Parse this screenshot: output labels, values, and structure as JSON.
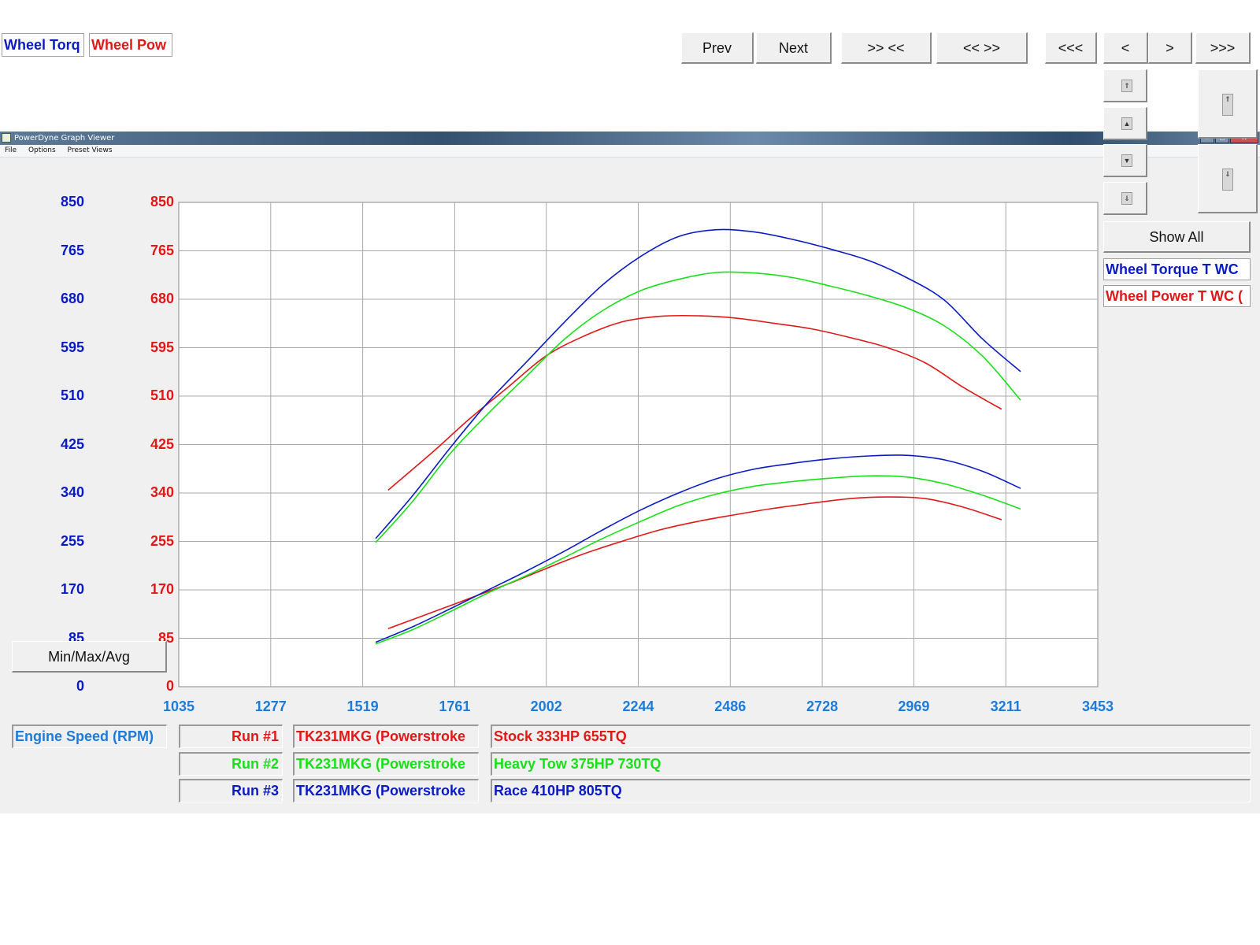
{
  "window": {
    "title": "PowerDyne Graph Viewer",
    "menu": [
      "File",
      "Options",
      "Preset Views"
    ],
    "controls": [
      "–",
      "□",
      "✕"
    ]
  },
  "header": {
    "left_axis_title": "Wheel Torq",
    "right_axis_title": "Wheel Pow"
  },
  "toolbar": {
    "prev": "Prev",
    "next": "Next",
    "zoom_in": ">> <<",
    "zoom_out": "<< >>",
    "pan_far_left": "<<<",
    "pan_left": "<",
    "pan_right": ">",
    "pan_far_right": ">>>"
  },
  "side": {
    "scroll_glyphs": [
      "⇑",
      "▲",
      "▼",
      "⇓"
    ],
    "scroll_tall_glyphs": [
      "⇑",
      "⇓"
    ],
    "show_all": "Show All",
    "legend": [
      {
        "label": "Wheel Torque T WC",
        "color": "#0b1bc4"
      },
      {
        "label": "Wheel Power T WC (",
        "color": "#e01818"
      }
    ]
  },
  "bottom": {
    "xaxis_title": "Engine Speed (RPM)",
    "minmax": "Min/Max/Avg",
    "runs": [
      {
        "run": "Run #1",
        "vehicle": "TK231MKG (Powerstroke",
        "desc": "Stock 333HP 655TQ",
        "color": "#e01818"
      },
      {
        "run": "Run #2",
        "vehicle": "TK231MKG (Powerstroke",
        "desc": "Heavy Tow 375HP 730TQ",
        "color": "#18e018"
      },
      {
        "run": "Run #3",
        "vehicle": "TK231MKG (Powerstroke",
        "desc": "Race 410HP 805TQ",
        "color": "#0b1bc4"
      }
    ]
  },
  "chart_data": {
    "type": "line",
    "xlabel": "Engine Speed (RPM)",
    "ylabel_left": "Wheel Torq",
    "ylabel_right": "Wheel Pow",
    "xlim": [
      1035,
      3453
    ],
    "ylim": [
      0,
      850
    ],
    "x_ticks": [
      1035,
      1277,
      1519,
      1761,
      2002,
      2244,
      2486,
      2728,
      2969,
      3211,
      3453
    ],
    "y_ticks": [
      0,
      85,
      170,
      255,
      340,
      425,
      510,
      595,
      680,
      765,
      850
    ],
    "grid": true,
    "left_tick_color": "#0b1bc4",
    "right_tick_color": "#e01818",
    "x_tick_color": "#1d7bd9",
    "series": [
      {
        "name": "Stock 333HP 655TQ",
        "metric": "Wheel Torque",
        "color": "#e01818",
        "x": [
          1586,
          1700,
          1800,
          1900,
          2000,
          2100,
          2200,
          2300,
          2400,
          2500,
          2600,
          2700,
          2800,
          2900,
          3000,
          3100,
          3200
        ],
        "y": [
          345,
          410,
          470,
          525,
          580,
          615,
          640,
          650,
          651,
          647,
          638,
          628,
          613,
          595,
          568,
          525,
          487
        ]
      },
      {
        "name": "Heavy Tow 375HP 730TQ",
        "metric": "Wheel Torque",
        "color": "#18e018",
        "x": [
          1553,
          1650,
          1750,
          1850,
          1950,
          2050,
          2150,
          2250,
          2350,
          2450,
          2550,
          2650,
          2750,
          2850,
          2950,
          3050,
          3150,
          3250
        ],
        "y": [
          253,
          325,
          410,
          480,
          545,
          610,
          660,
          695,
          715,
          727,
          726,
          718,
          703,
          686,
          665,
          633,
          580,
          503
        ]
      },
      {
        "name": "Race 410HP 805TQ",
        "metric": "Wheel Torque",
        "color": "#0b1bc4",
        "x": [
          1553,
          1650,
          1750,
          1850,
          1950,
          2050,
          2150,
          2250,
          2350,
          2450,
          2550,
          2650,
          2750,
          2850,
          2950,
          3050,
          3150,
          3250
        ],
        "y": [
          260,
          335,
          420,
          500,
          570,
          640,
          705,
          755,
          790,
          802,
          798,
          785,
          768,
          748,
          718,
          678,
          610,
          553
        ]
      },
      {
        "name": "Stock 333HP 655TQ",
        "metric": "Wheel Power",
        "color": "#e01818",
        "x": [
          1586,
          1700,
          1800,
          1900,
          2000,
          2100,
          2200,
          2300,
          2400,
          2500,
          2600,
          2700,
          2800,
          2900,
          3000,
          3100,
          3200
        ],
        "y": [
          102,
          130,
          155,
          180,
          207,
          233,
          255,
          275,
          290,
          302,
          313,
          322,
          330,
          333,
          330,
          315,
          293
        ]
      },
      {
        "name": "Heavy Tow 375HP 730TQ",
        "metric": "Wheel Power",
        "color": "#18e018",
        "x": [
          1553,
          1650,
          1750,
          1850,
          1950,
          2050,
          2150,
          2250,
          2350,
          2450,
          2550,
          2650,
          2750,
          2850,
          2950,
          3050,
          3150,
          3250
        ],
        "y": [
          75,
          100,
          132,
          165,
          195,
          227,
          260,
          290,
          318,
          338,
          352,
          360,
          366,
          370,
          368,
          356,
          336,
          312
        ]
      },
      {
        "name": "Race 410HP 805TQ",
        "metric": "Wheel Power",
        "color": "#0b1bc4",
        "x": [
          1553,
          1650,
          1750,
          1850,
          1950,
          2050,
          2150,
          2250,
          2350,
          2450,
          2550,
          2650,
          2750,
          2850,
          2950,
          3050,
          3150,
          3250
        ],
        "y": [
          78,
          105,
          137,
          170,
          203,
          238,
          275,
          310,
          340,
          365,
          382,
          392,
          400,
          405,
          406,
          398,
          378,
          348
        ]
      }
    ]
  }
}
